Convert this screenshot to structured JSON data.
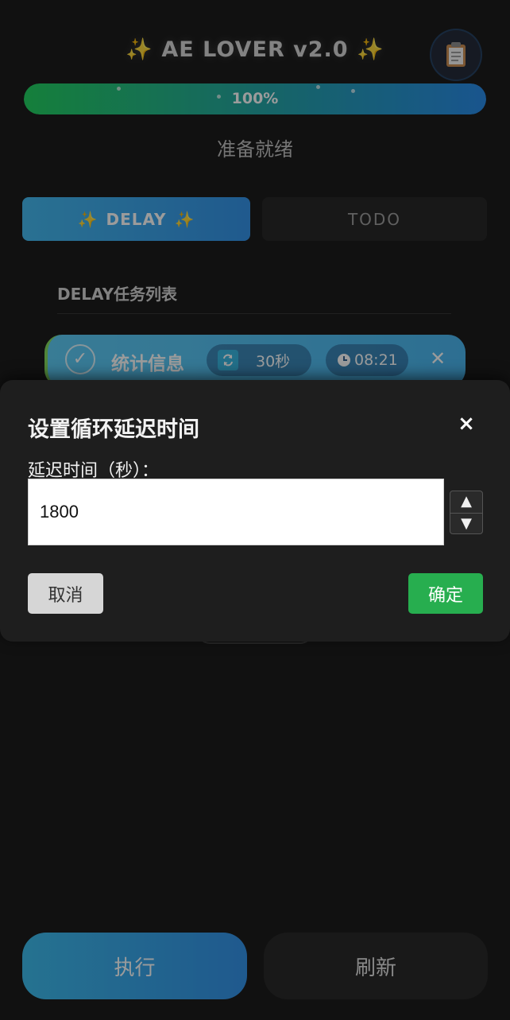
{
  "header": {
    "sparkle_left": "✨",
    "title": "AE LOVER v2.0",
    "sparkle_right": "✨",
    "clipboard_icon": "clipboard-icon"
  },
  "progress": {
    "value": 1.0,
    "label": "100%"
  },
  "status": "准备就绪",
  "tabs": [
    {
      "label": "DELAY",
      "sparkle": "✨",
      "active": true
    },
    {
      "label": "TODO",
      "active": false
    }
  ],
  "task_list": {
    "title": "DELAY任务列表",
    "items": [
      {
        "checked": true,
        "name": "统计信息",
        "loop_interval": "30秒",
        "time": "08:21"
      }
    ]
  },
  "modal": {
    "title": "设置循环延迟时间",
    "close": "×",
    "label": "延迟时间（秒）：",
    "input_value": "1800",
    "cancel": "取消",
    "confirm": "确定"
  },
  "footer": {
    "execute": "执行",
    "refresh": "刷新"
  },
  "colors": {
    "accent_blue": "#2b8fe8",
    "success_green": "#27ae4f",
    "background": "#111111"
  }
}
